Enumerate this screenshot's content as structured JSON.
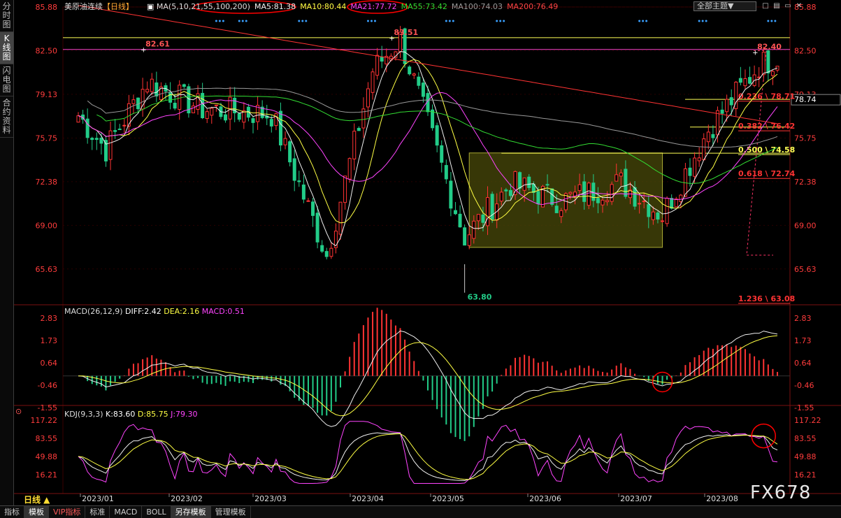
{
  "side_tabs": [
    "分时图",
    "K线图",
    "闪电图",
    "合约资料"
  ],
  "active_side_tab": 1,
  "header": {
    "instrument": "美原油连续",
    "period": "【日线】",
    "ma_title": "MA(5,10,21,55,100,200)",
    "ma": [
      {
        "label": "MA5:81.38",
        "color": "#f0f0f0"
      },
      {
        "label": "MA10:80.44",
        "color": "#ffff44"
      },
      {
        "label": "MA21:77.72",
        "color": "#ff44ff"
      },
      {
        "label": "MA55:73.42",
        "color": "#33dd33"
      },
      {
        "label": "MA100:74.03",
        "color": "#999999"
      },
      {
        "label": "MA200:76.49",
        "color": "#ff4444"
      }
    ],
    "theme_button": "全部主题▼",
    "window_buttons": [
      "□",
      "▤",
      "▭",
      "✕"
    ]
  },
  "price_axis": [
    "85.88",
    "82.50",
    "79.13",
    "75.75",
    "72.38",
    "69.00",
    "65.63"
  ],
  "macd_axis": [
    "2.83",
    "1.73",
    "0.64",
    "-0.46",
    "-1.55"
  ],
  "kdj_axis": [
    "117.22",
    "83.55",
    "49.88",
    "16.21"
  ],
  "date_labels": [
    "2023/01",
    "2023/02",
    "2023/03",
    "2023/04",
    "2023/05",
    "2023/06",
    "2023/07",
    "2023/08"
  ],
  "annotations": {
    "high1": "82.61",
    "high2": "83.51",
    "high3": "82.40",
    "low": "63.80",
    "price_tag": "78.74"
  },
  "fib_levels": [
    {
      "ratio": "0.236",
      "price": "78.71",
      "label": "0.236 \\ 78.71",
      "color": "#ff3333"
    },
    {
      "ratio": "0.382",
      "price": "76.42",
      "label": "0.382 \\ 76.42",
      "color": "#ff3333"
    },
    {
      "ratio": "0.500",
      "price": "74.58",
      "label": "0.500 \\ 74.58",
      "color": "#ffff55"
    },
    {
      "ratio": "0.618",
      "price": "72.74",
      "label": "0.618 \\ 72.74",
      "color": "#ff3333"
    },
    {
      "ratio": "1.236",
      "price": "63.08",
      "label": "1.236 \\ 63.08",
      "color": "#ff3333"
    }
  ],
  "macd_header": {
    "title": "MACD(26,12,9)",
    "diff": "DIFF:2.42",
    "dea": "DEA:2.16",
    "macd": "MACD:0.51"
  },
  "kdj_header": {
    "title": "KDJ(9,3,3)",
    "k": "K:83.60",
    "d": "D:85.75",
    "j": "J:79.30"
  },
  "period_button": "日线 ▲",
  "bottom_tabs": [
    "指标",
    "模板",
    "VIP指标",
    "标准",
    "MACD",
    "BOLL",
    "另存模板",
    "管理模板"
  ],
  "watermark": "FX678",
  "colors": {
    "up": "#ff3333",
    "down": "#22cc88",
    "bg": "#000000",
    "box": "#5a5a10"
  },
  "chart_data": [
    {
      "type": "candlestick",
      "title": "美原油连续 日线",
      "x_range": [
        "2023/01",
        "2023/08"
      ],
      "ylim": [
        63.08,
        85.88
      ],
      "annotated_high": [
        82.61,
        83.51,
        82.4
      ],
      "annotated_low": 63.8,
      "ma": {
        "MA5": 81.38,
        "MA10": 80.44,
        "MA21": 77.72,
        "MA55": 73.42,
        "MA100": 74.03,
        "MA200": 76.49
      },
      "close_anchors": {
        "dates": [
          "2023/01/03",
          "2023/01/10",
          "2023/01/25",
          "2023/02/10",
          "2023/03/01",
          "2023/03/17",
          "2023/04/03",
          "2023/04/12",
          "2023/05/03",
          "2023/05/15",
          "2023/06/01",
          "2023/06/20",
          "2023/07/03",
          "2023/07/13",
          "2023/08/01"
        ],
        "values": [
          77.5,
          74.9,
          80.1,
          78.0,
          77.6,
          66.7,
          81.0,
          83.4,
          68.1,
          72.2,
          70.9,
          72.3,
          69.8,
          76.4,
          81.4
        ]
      }
    },
    {
      "type": "line",
      "title": "MACD(26,12,9)",
      "series": [
        {
          "name": "DIFF",
          "last": 2.42
        },
        {
          "name": "DEA",
          "last": 2.16
        },
        {
          "name": "MACD",
          "last": 0.51
        }
      ],
      "ylim": [
        -1.55,
        2.83
      ]
    },
    {
      "type": "line",
      "title": "KDJ(9,3,3)",
      "series": [
        {
          "name": "K",
          "last": 83.6
        },
        {
          "name": "D",
          "last": 85.75
        },
        {
          "name": "J",
          "last": 79.3
        }
      ],
      "ylim": [
        16.21,
        117.22
      ]
    }
  ]
}
